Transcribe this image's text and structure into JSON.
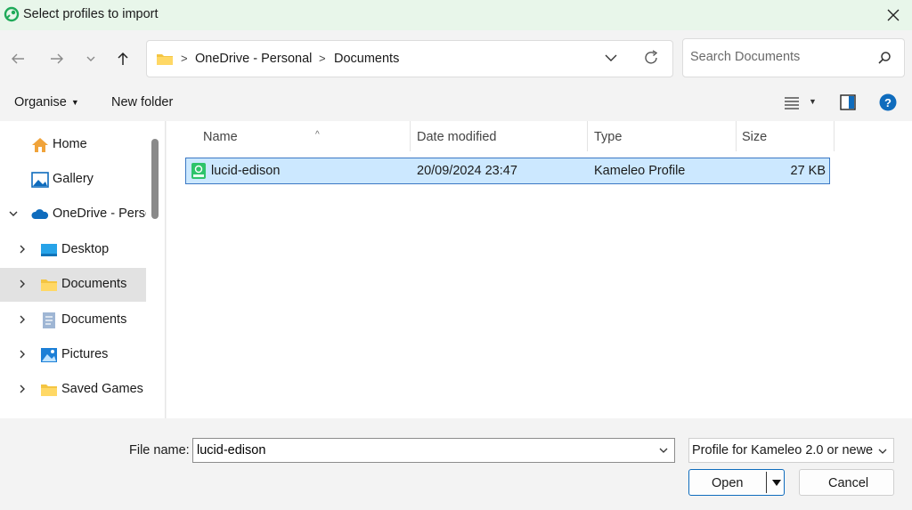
{
  "window": {
    "title": "Select profiles to import"
  },
  "address": {
    "crumbs": [
      "OneDrive - Personal",
      "Documents"
    ]
  },
  "search": {
    "placeholder": "Search Documents"
  },
  "toolbar": {
    "organise": "Organise",
    "new_folder": "New folder"
  },
  "sidebar": {
    "items": [
      {
        "label": "Home",
        "icon": "home-icon"
      },
      {
        "label": "Gallery",
        "icon": "gallery-icon"
      },
      {
        "label": "OneDrive - Personal",
        "icon": "cloud-icon"
      },
      {
        "label": "Desktop",
        "icon": "desktop-icon"
      },
      {
        "label": "Documents",
        "icon": "folder-icon"
      },
      {
        "label": "Documents",
        "icon": "documents-icon"
      },
      {
        "label": "Pictures",
        "icon": "pictures-icon"
      },
      {
        "label": "Saved Games",
        "icon": "folder-icon"
      }
    ]
  },
  "columns": {
    "name": "Name",
    "date": "Date modified",
    "type": "Type",
    "size": "Size"
  },
  "files": [
    {
      "name": "lucid-edison",
      "date": "20/09/2024 23:47",
      "type": "Kameleo Profile",
      "size": "27 KB"
    }
  ],
  "footer": {
    "file_name_label": "File name:",
    "file_name_value": "lucid-edison",
    "filter": "Profile for Kameleo 2.0 or newe",
    "open": "Open",
    "cancel": "Cancel"
  },
  "colors": {
    "accent": "#0f6cbd",
    "selection": "#cce8ff",
    "titlebar": "#e8f6ea"
  }
}
